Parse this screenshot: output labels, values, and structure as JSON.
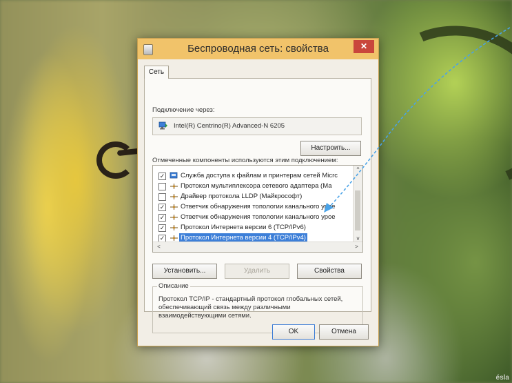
{
  "window": {
    "title": "Беспроводная сеть: свойства",
    "close_glyph": "✕"
  },
  "tab": {
    "label": "Сеть"
  },
  "connection": {
    "label": "Подключение через:",
    "adapter_name": "Intel(R) Centrino(R) Advanced-N 6205",
    "adapter_icon": "network-adapter-icon"
  },
  "configure_button": "Настроить...",
  "components": {
    "label": "Отмеченные компоненты используются этим подключением:",
    "items": [
      {
        "checked": true,
        "text": "Служба доступа к файлам и принтерам сетей Micrc",
        "icon": "file-printer-share-icon",
        "selected": false
      },
      {
        "checked": false,
        "text": "Протокол мультиплексора сетевого адаптера (Ма",
        "icon": "protocol-icon",
        "selected": false
      },
      {
        "checked": false,
        "text": "Драйвер протокола LLDP (Майкрософт)",
        "icon": "protocol-icon",
        "selected": false
      },
      {
        "checked": true,
        "text": "Ответчик обнаружения топологии канального урое",
        "icon": "protocol-icon",
        "selected": false
      },
      {
        "checked": true,
        "text": "Ответчик обнаружения топологии канального урое",
        "icon": "protocol-icon",
        "selected": false
      },
      {
        "checked": true,
        "text": "Протокол Интернета версии 6 (TCP/IPv6)",
        "icon": "protocol-icon",
        "selected": false
      },
      {
        "checked": true,
        "text": "Протокол Интернета версии 4 (TCP/IPv4)",
        "icon": "protocol-icon",
        "selected": true
      }
    ],
    "scroll_up": "^",
    "scroll_down": "v",
    "scroll_left": "<",
    "scroll_right": ">"
  },
  "buttons": {
    "install": "Установить...",
    "uninstall": "Удалить",
    "properties": "Свойства",
    "ok": "OK",
    "cancel": "Отмена"
  },
  "description": {
    "legend": "Описание",
    "text": "Протокол TCP/IP - стандартный протокол глобальных сетей, обеспечивающий связь между различными взаимодействующими сетями."
  },
  "colors": {
    "titlebar": "#f1c36a",
    "close": "#c9463c",
    "selection": "#3d7fd8",
    "annotation_arrow": "#4aa3e8"
  },
  "watermark": "ésla"
}
